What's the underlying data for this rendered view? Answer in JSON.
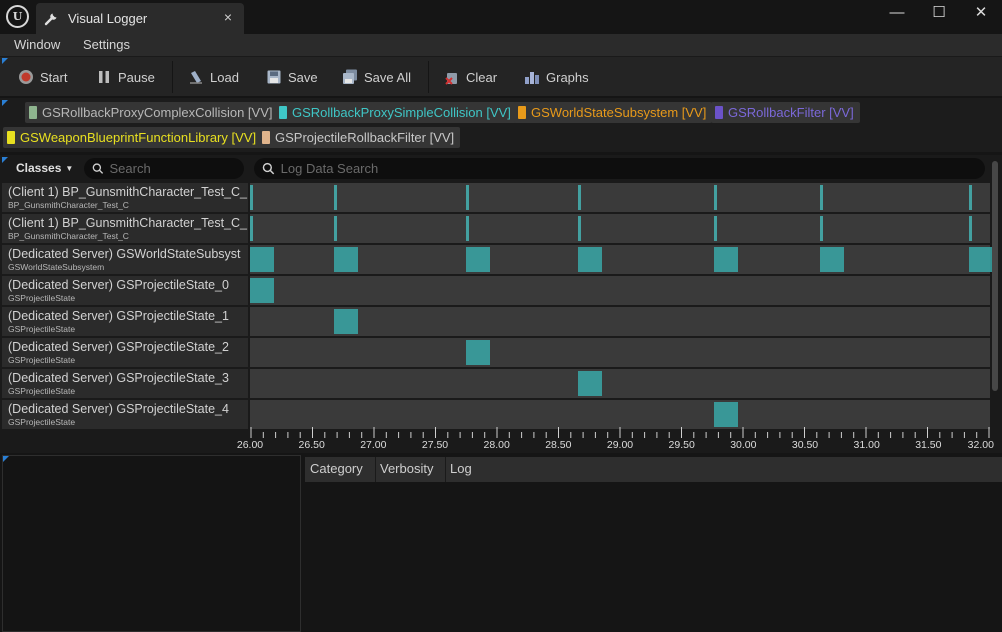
{
  "window": {
    "tab_title": "Visual Logger",
    "close_glyph": "×",
    "controls": {
      "minimize": "—",
      "maximize": "☐",
      "close": "✕"
    }
  },
  "menu": [
    "Window",
    "Settings"
  ],
  "toolbar": {
    "start": "Start",
    "pause": "Pause",
    "load": "Load",
    "save": "Save",
    "save_all": "Save All",
    "clear": "Clear",
    "graphs": "Graphs"
  },
  "filters": [
    {
      "label": "GSRollbackProxyComplexCollision [VV]",
      "color": "#8fb58f",
      "text_color": "#b8b8b8"
    },
    {
      "label": "GSRollbackProxySimpleCollision [VV]",
      "color": "#3fc6c6",
      "text_color": "#3fc6c6"
    },
    {
      "label": "GSWorldStateSubsystem [VV]",
      "color": "#e89a1a",
      "text_color": "#e89a1a"
    },
    {
      "label": "GSRollbackFilter [VV]",
      "color": "#6b52c8",
      "text_color": "#7b68d8"
    },
    {
      "label": "GSWeaponBlueprintFunctionLibrary [VV]",
      "color": "#e8e020",
      "text_color": "#e8e020"
    },
    {
      "label": "GSProjectileRollbackFilter [VV]",
      "color": "#e0b48c",
      "text_color": "#c8c8c8"
    }
  ],
  "timeline": {
    "classes_label": "Classes",
    "search_placeholder": "Search",
    "log_search_placeholder": "Log Data Search",
    "rows": [
      {
        "name": "(Client 1) BP_GunsmithCharacter_Test_C_",
        "class": "BP_GunsmithCharacter_Test_C",
        "events": [
          26.0,
          26.68,
          27.75,
          28.66,
          29.76,
          30.62,
          31.83
        ],
        "kind": "thin"
      },
      {
        "name": "(Client 1) BP_GunsmithCharacter_Test_C_",
        "class": "BP_GunsmithCharacter_Test_C",
        "events": [
          26.0,
          26.68,
          27.75,
          28.66,
          29.76,
          30.62,
          31.83
        ],
        "kind": "thin"
      },
      {
        "name": "(Dedicated Server) GSWorldStateSubsyst",
        "class": "GSWorldStateSubsystem",
        "events": [
          26.0,
          26.68,
          27.75,
          28.66,
          29.76,
          30.62,
          31.83
        ],
        "kind": "wide"
      },
      {
        "name": "(Dedicated Server) GSProjectileState_0",
        "class": "GSProjectileState",
        "events": [
          26.0
        ],
        "kind": "wide"
      },
      {
        "name": "(Dedicated Server) GSProjectileState_1",
        "class": "GSProjectileState",
        "events": [
          26.68
        ],
        "kind": "wide"
      },
      {
        "name": "(Dedicated Server) GSProjectileState_2",
        "class": "GSProjectileState",
        "events": [
          27.75
        ],
        "kind": "wide"
      },
      {
        "name": "(Dedicated Server) GSProjectileState_3",
        "class": "GSProjectileState",
        "events": [
          28.66
        ],
        "kind": "wide"
      },
      {
        "name": "(Dedicated Server) GSProjectileState_4",
        "class": "GSProjectileState",
        "events": [
          29.76
        ],
        "kind": "wide"
      }
    ],
    "axis": {
      "min": 26.0,
      "max": 32.0,
      "labels": [
        "26.00",
        "26.50",
        "27.00",
        "27.50",
        "28.00",
        "28.50",
        "29.00",
        "29.50",
        "30.00",
        "30.50",
        "31.00",
        "31.50",
        "32.00"
      ]
    }
  },
  "log_columns": [
    "Category",
    "Verbosity",
    "Log"
  ]
}
